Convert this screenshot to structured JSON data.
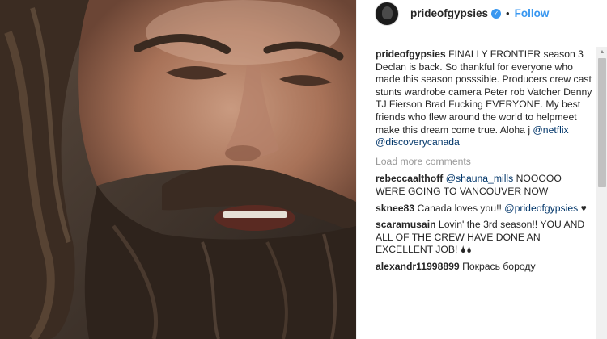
{
  "post": {
    "username": "prideofgypsies",
    "verified_glyph": "✓",
    "separator": "•",
    "follow_label": "Follow"
  },
  "caption": {
    "username": "prideofgypsies",
    "text": "FINALLY FRONTIER season 3 Declan is back. So thankful for everyone who made this season posssible. Producers crew cast stunts wardrobe camera Peter rob Vatcher Denny TJ Fierson Brad Fucking EVERYONE. My best friends who flew around the world to helpmeet make this dream come true. Aloha j ",
    "mention_1": "@netflix",
    "mention_2": "@discoverycanada"
  },
  "load_more_label": "Load more comments",
  "comments": [
    {
      "username": "rebeccaalthoff",
      "mention": "@shauna_mills",
      "text": " NOOOOO WERE GOING TO VANCOUVER NOW"
    },
    {
      "username": "sknee83",
      "text": " Canada loves you!! ",
      "mention": "@prideofgypsies",
      "suffix": " ♥"
    },
    {
      "username": "scaramusain",
      "text": " Lovin' the 3rd season!! YOU AND ALL OF THE CREW HAVE DONE AN EXCELLENT JOB! 🌢🌢"
    },
    {
      "username": "alexandr11998899",
      "text": " Покрась бороду"
    }
  ],
  "icons": {
    "avatar": "profile-avatar",
    "verified": "verified-badge-icon",
    "scroll_up": "scroll-up-arrow",
    "scroll_down": "scroll-down-arrow"
  },
  "colors": {
    "link_blue": "#3897f0",
    "mention_blue": "#003569",
    "muted_gray": "#999999"
  }
}
